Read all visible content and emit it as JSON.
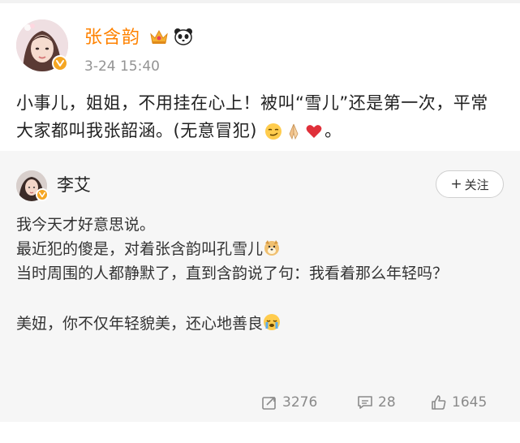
{
  "post": {
    "author_name": "张含韵",
    "time": "3-24 15:40",
    "badges": [
      "crown-icon",
      "panda-icon"
    ],
    "text_main": "小事儿，姐姐，不用挂在心上！被叫“雪儿”还是第一次，平常大家都叫我张韶涵。(无意冒犯)",
    "text_tail": "。",
    "emojis": [
      "smirk-face-icon",
      "praying-hands-icon",
      "red-heart-icon"
    ]
  },
  "repost": {
    "author_name": "李艾",
    "follow_label": "关注",
    "lines": [
      "我今天才好意思说。",
      "最近犯的傻是，对着张含韵叫孔雪儿",
      "当时周围的人都静默了，直到含韵说了句：我看着那么年轻吗？",
      "美妞，你不仅年轻貌美，还心地善良"
    ],
    "line_emojis": [
      "doge-icon",
      "crying-face-icon"
    ],
    "actions": {
      "repost_count": "3276",
      "comment_count": "28",
      "like_count": "1645"
    }
  },
  "colors": {
    "author_orange": "#ff8200",
    "verified_badge": "#f5a623",
    "repost_bg": "#f6f6f6",
    "meta_gray": "#939393"
  }
}
